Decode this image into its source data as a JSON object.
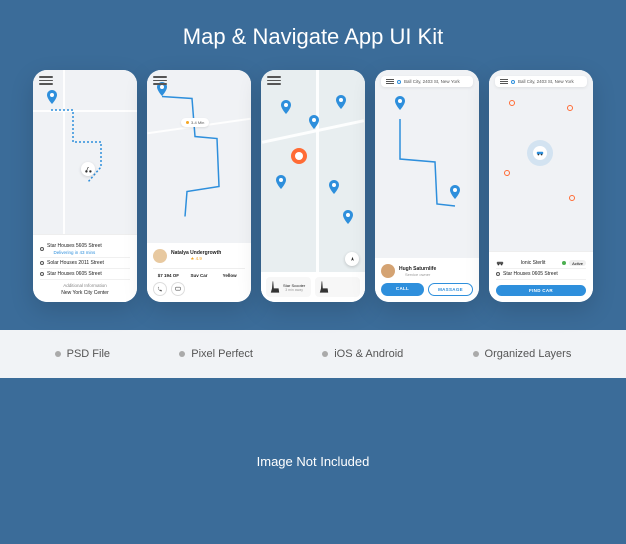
{
  "title": "Map & Navigate App UI Kit",
  "features": [
    "PSD File",
    "Pixel Perfect",
    "iOS & Android",
    "Organized Layers"
  ],
  "footer": "Image Not Included",
  "colors": {
    "accent": "#2e8fdc",
    "bg": "#3b6c99",
    "orange": "#ff6b35"
  },
  "screen1": {
    "addr1": "Star Houses 5605 Street",
    "delivery": "Delivering in 43 mins",
    "addr2": "Solar Houses 2011 Street",
    "addr3": "Star Houses 0605 Street",
    "addl": "Additional Information",
    "city": "New York City Center"
  },
  "screen2": {
    "chip": "3-4 Min",
    "driver": "Natalya Undergrowth",
    "rating": "★ 4.9",
    "stat1": {
      "val": "$7 194 OF",
      "lbl": ""
    },
    "stat2": {
      "val": "Suv Car",
      "lbl": ""
    },
    "stat3": {
      "val": "Yellow",
      "lbl": ""
    }
  },
  "screen3": {
    "scooter": "Star Scooter",
    "scooter_sub": "3 min away"
  },
  "screen4": {
    "search": "Ball City, 2403 St, New York",
    "driver": "Hugh Saturnlife",
    "driver_sub": "Service owner",
    "btn_call": "CALL",
    "btn_msg": "MASSAGE"
  },
  "screen5": {
    "search": "Ball City, 2403 St, New York",
    "row1": "Ionic Sterlit",
    "row1_status": "Active",
    "row2": "Star Houses 0605 Street",
    "btn": "FIND CAR"
  }
}
